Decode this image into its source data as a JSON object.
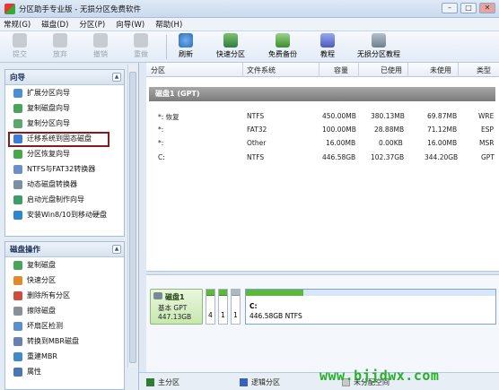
{
  "window": {
    "title": "分区助手专业版 - 无损分区免费软件"
  },
  "menubar": {
    "items": [
      "常规(G)",
      "磁盘(D)",
      "分区(P)",
      "向导(W)",
      "帮助(H)"
    ]
  },
  "toolbar": {
    "commit": "提交",
    "discard": "放弃",
    "undo": "撤销",
    "redo": "重做",
    "refresh": "刷新",
    "quick_partition": "快速分区",
    "free_backup": "免费备份",
    "tutorial": "教程",
    "lossless_tutorial": "无损分区教程"
  },
  "wizard_panel": {
    "title": "向导",
    "items": [
      "扩展分区向导",
      "复制磁盘向导",
      "复制分区向导",
      "迁移系统到固态磁盘",
      "分区恢复向导",
      "NTFS与FAT32转换器",
      "动态磁盘转换器",
      "启动光盘制作向导",
      "安装Win8/10到移动硬盘"
    ]
  },
  "disk_ops_panel": {
    "title": "磁盘操作",
    "items": [
      "复制磁盘",
      "快速分区",
      "删除所有分区",
      "擦除磁盘",
      "坏扇区检测",
      "转换到MBR磁盘",
      "重建MBR",
      "属性"
    ]
  },
  "table": {
    "headers": [
      "分区",
      "文件系统",
      "容量",
      "已使用",
      "未使用",
      "类型"
    ],
    "disk_label": "磁盘1 (GPT)",
    "rows": [
      {
        "name": "*: 恢复",
        "fs": "NTFS",
        "capacity": "450.00MB",
        "used": "380.13MB",
        "free": "69.87MB",
        "type": "WRE"
      },
      {
        "name": "*:",
        "fs": "FAT32",
        "capacity": "100.00MB",
        "used": "28.88MB",
        "free": "71.12MB",
        "type": "ESP"
      },
      {
        "name": "*:",
        "fs": "Other",
        "capacity": "16.00MB",
        "used": "0.00KB",
        "free": "16.00MB",
        "type": "MSR"
      },
      {
        "name": "C:",
        "fs": "NTFS",
        "capacity": "446.58GB",
        "used": "102.37GB",
        "free": "344.20GB",
        "type": "GPT"
      }
    ]
  },
  "disk_map": {
    "disk_name": "磁盘1",
    "disk_type": "基本 GPT",
    "disk_size": "447.13GB",
    "small_parts": [
      "4",
      "1",
      "1"
    ],
    "c_label": "C:",
    "c_detail": "446.58GB NTFS",
    "c_used_fraction": 0.23
  },
  "status": {
    "primary": "主分区",
    "logical": "逻辑分区",
    "unallocated": "未分配空间"
  },
  "watermark": "www.bjjdwx.com",
  "colors": {
    "primary": "#2e7d32",
    "logical": "#3a63b8",
    "used": "#5cb83c",
    "highlight": "#8b1a1a"
  }
}
